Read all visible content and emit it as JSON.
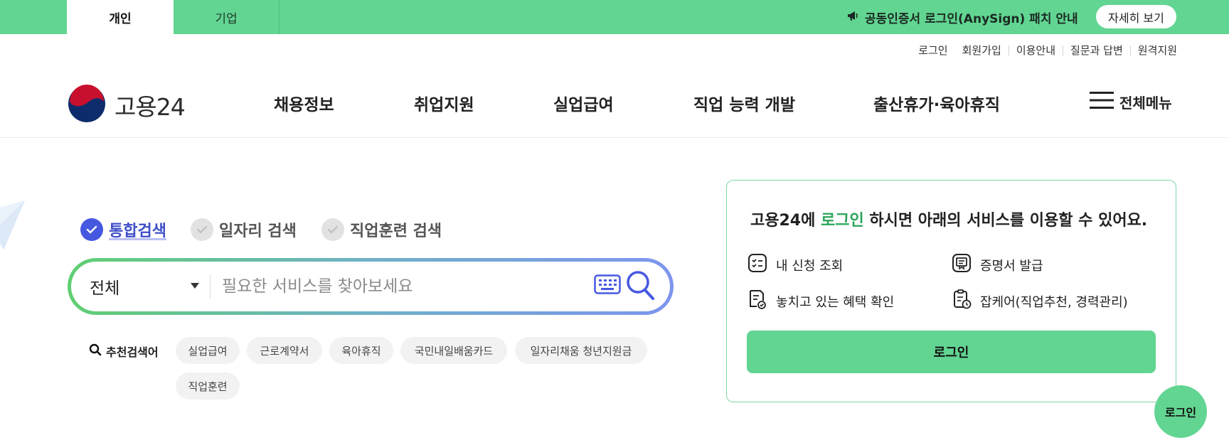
{
  "topbar": {
    "tabs": [
      {
        "label": "개인"
      },
      {
        "label": "기업"
      }
    ],
    "notice_text": "공동인증서 로그인(AnySign) 패치 안내",
    "detail_button": "자세히 보기"
  },
  "util_links": [
    "로그인",
    "회원가입",
    "이용안내",
    "질문과 답변",
    "원격지원"
  ],
  "logo": {
    "text": "고용24"
  },
  "gnb": [
    "채용정보",
    "취업지원",
    "실업급여",
    "직업 능력 개발",
    "출산휴가·육아휴직"
  ],
  "all_menu": "전체메뉴",
  "search": {
    "types": [
      {
        "label": "통합검색",
        "checked": true
      },
      {
        "label": "일자리 검색",
        "checked": false
      },
      {
        "label": "직업훈련 검색",
        "checked": false
      }
    ],
    "scope": "전체",
    "placeholder": "필요한 서비스를 찾아보세요",
    "recommend_label": "추천검색어",
    "keywords": [
      "실업급여",
      "근로계약서",
      "육아휴직",
      "국민내일배움카드",
      "일자리채움 청년지원금",
      "직업훈련"
    ]
  },
  "login_card": {
    "brand": "고용24에",
    "highlight": "로그인",
    "rest": "하시면 아래의 서비스를 이용할 수 있어요.",
    "services": [
      "내 신청 조회",
      "증명서 발급",
      "놓치고 있는 혜택 확인",
      "잡케어(직업추천, 경력관리)"
    ],
    "login_button": "로그인"
  },
  "fab_label": "로그인",
  "colors": {
    "brand_green": "#62d592",
    "accent_blue": "#4658e0",
    "highlight_green": "#2aa45a"
  }
}
